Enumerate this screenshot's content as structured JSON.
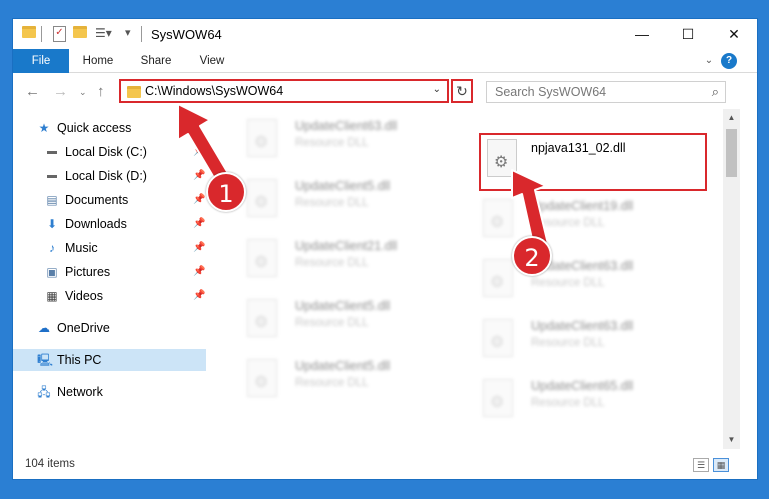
{
  "window": {
    "title": "SysWOW64",
    "controls": {
      "minimize": "—",
      "maximize": "☐",
      "close": "✕"
    }
  },
  "ribbon": {
    "tabs": [
      "File",
      "Home",
      "Share",
      "View"
    ],
    "help": "?"
  },
  "address": {
    "path": "C:\\Windows\\SysWOW64"
  },
  "search": {
    "placeholder": "Search SysWOW64"
  },
  "nav": {
    "quick_access": "Quick access",
    "items": [
      {
        "label": "Local Disk (C:)",
        "icon": "drive-icon"
      },
      {
        "label": "Local Disk (D:)",
        "icon": "drive-icon"
      },
      {
        "label": "Documents",
        "icon": "documents-icon"
      },
      {
        "label": "Downloads",
        "icon": "downloads-icon"
      },
      {
        "label": "Music",
        "icon": "music-icon"
      },
      {
        "label": "Pictures",
        "icon": "pictures-icon"
      },
      {
        "label": "Videos",
        "icon": "videos-icon"
      }
    ],
    "onedrive": "OneDrive",
    "this_pc": "This PC",
    "network": "Network"
  },
  "files": {
    "left_column": [
      {
        "name": "UpdateClient63.dll",
        "type": "Resource DLL"
      },
      {
        "name": "UpdateClient5.dll",
        "type": "Resource DLL"
      },
      {
        "name": "UpdateClient21.dll",
        "type": "Resource DLL"
      },
      {
        "name": "UpdateClient5.dll",
        "type": "Resource DLL"
      },
      {
        "name": "UpdateClient5.dll",
        "type": "Resource DLL"
      }
    ],
    "right_column": [
      {
        "name": "npjava131_02.dll",
        "type": ""
      },
      {
        "name": "UpdateClient19.dll",
        "type": "Resource DLL"
      },
      {
        "name": "UpdateClient63.dll",
        "type": "Resource DLL"
      },
      {
        "name": "UpdateClient63.dll",
        "type": "Resource DLL"
      },
      {
        "name": "UpdateClient65.dll",
        "type": "Resource DLL"
      }
    ]
  },
  "status": {
    "item_count": "104 items"
  },
  "callouts": {
    "one": "1",
    "two": "2"
  },
  "colors": {
    "accent": "#1979ca",
    "highlight": "#d9282c",
    "selected": "#cce4f7"
  }
}
